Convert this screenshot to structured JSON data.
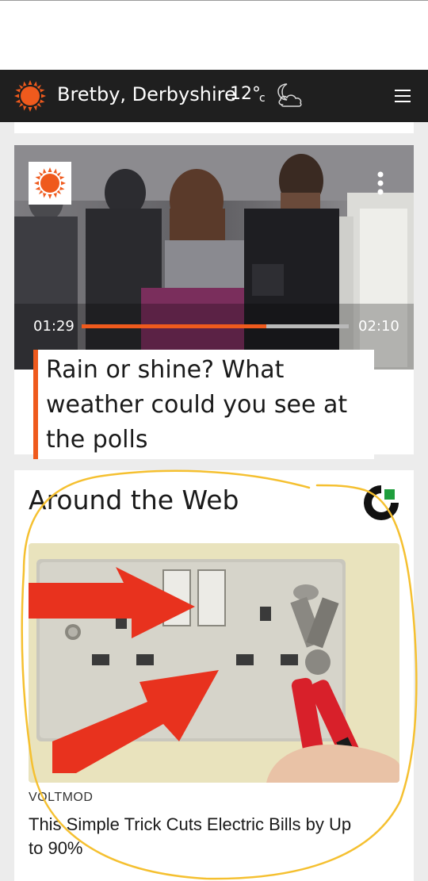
{
  "header": {
    "location": "Bretby, Derbyshire",
    "temperature": "12°",
    "unit": "c",
    "icons": {
      "weather": "sun-icon",
      "forecast": "crescent-moon-cloud-icon",
      "menu": "hamburger-menu-icon"
    }
  },
  "video": {
    "current_time": "01:29",
    "duration": "02:10",
    "progress": 0.69,
    "headline": "Rain or shine? What weather could you see at the polls",
    "icons": {
      "logo": "sun-logo-icon",
      "options": "kebab-menu-icon"
    }
  },
  "web": {
    "section_title": "Around the Web",
    "ad_source": "VOLTMOD",
    "ad_title": "This Simple Trick Cuts Electric Bills by Up to 90%",
    "icons": {
      "provider": "outbrain-logo-icon"
    }
  },
  "colors": {
    "accent": "#ef5a1d",
    "header_bg": "#1f1f1f",
    "annotation": "#f5c030",
    "page_bg": "#ececec"
  }
}
